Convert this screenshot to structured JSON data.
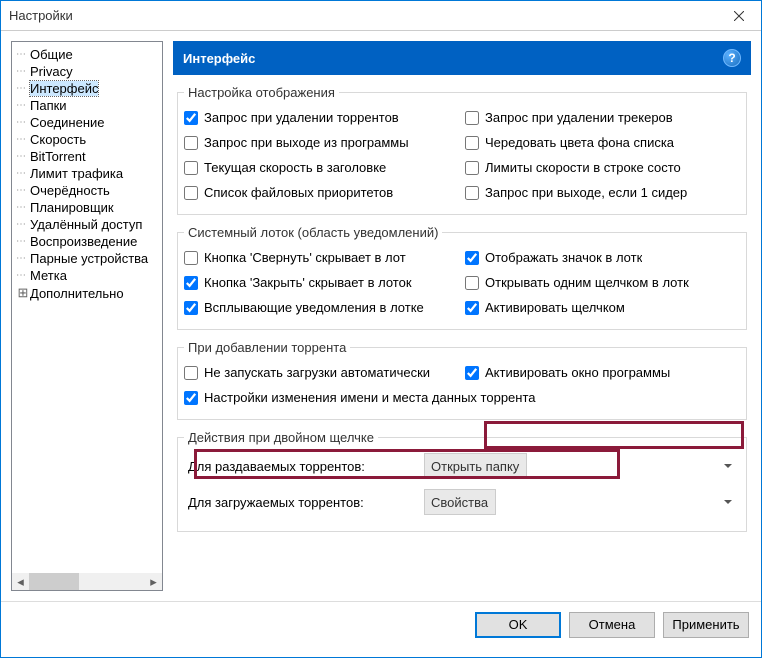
{
  "window": {
    "title": "Настройки"
  },
  "sidebar": {
    "items": [
      {
        "label": "Общие"
      },
      {
        "label": "Privacy"
      },
      {
        "label": "Интерфейс",
        "selected": true
      },
      {
        "label": "Папки"
      },
      {
        "label": "Соединение"
      },
      {
        "label": "Скорость"
      },
      {
        "label": "BitTorrent"
      },
      {
        "label": "Лимит трафика"
      },
      {
        "label": "Очерёдность"
      },
      {
        "label": "Планировщик"
      },
      {
        "label": "Удалённый доступ"
      },
      {
        "label": "Воспроизведение"
      },
      {
        "label": "Парные устройства"
      },
      {
        "label": "Метка"
      }
    ],
    "expandable": {
      "label": "Дополнительно"
    }
  },
  "header": {
    "title": "Интерфейс"
  },
  "group_display": {
    "legend": "Настройка отображения",
    "left": [
      {
        "label": "Запрос при удалении торрентов",
        "checked": true
      },
      {
        "label": "Запрос при выходе из программы",
        "checked": false
      },
      {
        "label": "Текущая скорость в заголовке",
        "checked": false
      },
      {
        "label": "Список файловых приоритетов",
        "checked": false
      }
    ],
    "right": [
      {
        "label": "Запрос при удалении трекеров",
        "checked": false
      },
      {
        "label": "Чередовать цвета фона списка",
        "checked": false
      },
      {
        "label": "Лимиты скорости в строке состо",
        "checked": false
      },
      {
        "label": "Запрос при выходе, если 1 сидер",
        "checked": false
      }
    ]
  },
  "group_tray": {
    "legend": "Системный лоток (область уведомлений)",
    "left": [
      {
        "label": "Кнопка 'Свернуть' скрывает в лот",
        "checked": false
      },
      {
        "label": "Кнопка 'Закрыть' скрывает в лоток",
        "checked": true
      },
      {
        "label": "Всплывающие уведомления в лотке",
        "checked": true
      }
    ],
    "right": [
      {
        "label": "Отображать значок в лотк",
        "checked": true
      },
      {
        "label": "Открывать одним щелчком в лотк",
        "checked": false
      },
      {
        "label": "Активировать щелчком",
        "checked": true
      }
    ]
  },
  "group_add": {
    "legend": "При добавлении торрента",
    "row1_left": {
      "label": "Не запускать загрузки автоматически",
      "checked": false
    },
    "row1_right": {
      "label": "Активировать окно программы",
      "checked": true
    },
    "row2": {
      "label": "Настройки изменения имени и места данных торрента",
      "checked": true
    }
  },
  "group_dblclick": {
    "legend": "Действия при двойном щелчке",
    "seeding_label": "Для раздаваемых торрентов:",
    "seeding_value": "Открыть папку",
    "downloading_label": "Для загружаемых торрентов:",
    "downloading_value": "Свойства"
  },
  "footer": {
    "ok": "OK",
    "cancel": "Отмена",
    "apply": "Применить"
  }
}
